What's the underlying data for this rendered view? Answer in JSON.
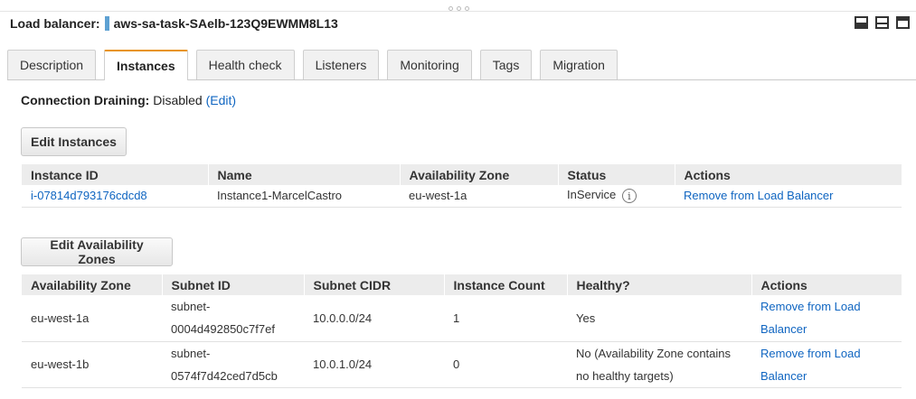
{
  "header": {
    "label": "Load balancer:",
    "name": "aws-sa-task-SAelb-123Q9EWMM8L13"
  },
  "tabs": [
    {
      "label": "Description"
    },
    {
      "label": "Instances"
    },
    {
      "label": "Health check"
    },
    {
      "label": "Listeners"
    },
    {
      "label": "Monitoring"
    },
    {
      "label": "Tags"
    },
    {
      "label": "Migration"
    }
  ],
  "active_tab": "Instances",
  "connection_draining": {
    "label": "Connection Draining:",
    "value": "Disabled",
    "edit_link": "(Edit)"
  },
  "instances": {
    "button": "Edit Instances",
    "columns": [
      "Instance ID",
      "Name",
      "Availability Zone",
      "Status",
      "Actions"
    ],
    "rows": [
      {
        "id": "i-07814d793176cdcd8",
        "name": "Instance1-MarcelCastro",
        "zone": "eu-west-1a",
        "status": "InService",
        "action": "Remove from Load Balancer"
      }
    ]
  },
  "availability_zones": {
    "button": "Edit Availability Zones",
    "columns": [
      "Availability Zone",
      "Subnet ID",
      "Subnet CIDR",
      "Instance Count",
      "Healthy?",
      "Actions"
    ],
    "rows": [
      {
        "zone": "eu-west-1a",
        "subnet_line1": "subnet-",
        "subnet_line2": "0004d492850c7f7ef",
        "cidr": "10.0.0.0/24",
        "count": "1",
        "healthy_line1": "Yes",
        "healthy_line2": "",
        "action_line1": "Remove from Load",
        "action_line2": "Balancer"
      },
      {
        "zone": "eu-west-1b",
        "subnet_line1": "subnet-",
        "subnet_line2": "0574f7d42ced7d5cb",
        "cidr": "10.0.1.0/24",
        "count": "0",
        "healthy_line1": "No (Availability Zone contains",
        "healthy_line2": "no healthy targets)",
        "action_line1": "Remove from Load",
        "action_line2": "Balancer"
      }
    ]
  },
  "icons": {
    "layout": [
      "layout-bottom-panel-icon",
      "layout-split-icon",
      "layout-top-panel-icon"
    ],
    "status_info": "info-icon"
  },
  "colors": {
    "accent_tab": "#e8941a",
    "link": "#0f65c1",
    "header_marker": "#5ea1d3"
  }
}
